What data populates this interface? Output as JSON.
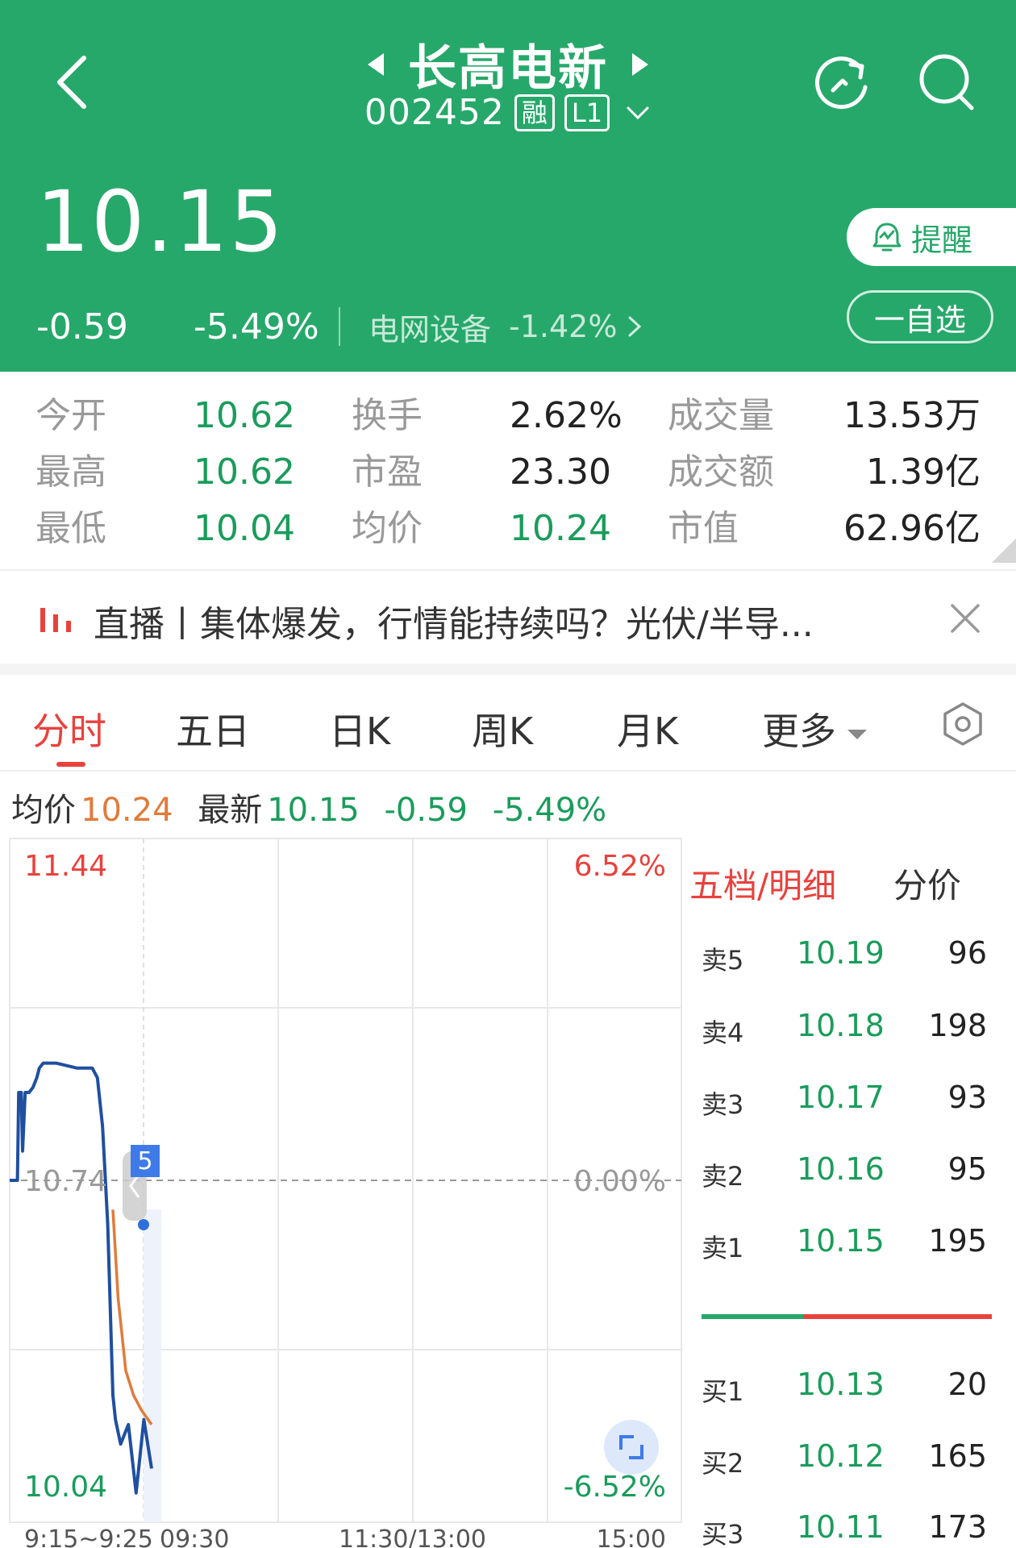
{
  "header": {
    "title": "长高电新",
    "code": "002452",
    "tag_margin": "融",
    "tag_level": "L1",
    "price": "10.15",
    "change": "-0.59",
    "change_pct": "-5.49%",
    "sector_name": "电网设备",
    "sector_change": "-1.42%",
    "remind_label": "提醒",
    "watchlist_label": "一自选"
  },
  "stats": [
    {
      "label": "今开",
      "value": "10.62",
      "color": "green"
    },
    {
      "label": "换手",
      "value": "2.62%",
      "color": "dark"
    },
    {
      "label": "成交量",
      "value": "13.53万",
      "color": "dark"
    },
    {
      "label": "最高",
      "value": "10.62",
      "color": "green"
    },
    {
      "label": "市盈",
      "value": "23.30",
      "color": "dark"
    },
    {
      "label": "成交额",
      "value": "1.39亿",
      "color": "dark"
    },
    {
      "label": "最低",
      "value": "10.04",
      "color": "green"
    },
    {
      "label": "均价",
      "value": "10.24",
      "color": "green"
    },
    {
      "label": "市值",
      "value": "62.96亿",
      "color": "dark"
    }
  ],
  "news": {
    "text": "直播丨集体爆发，行情能持续吗？光伏/半导..."
  },
  "tabs": [
    "分时",
    "五日",
    "日K",
    "周K",
    "月K",
    "更多"
  ],
  "info_line": {
    "avg_label": "均价",
    "avg_value": "10.24",
    "latest_label": "最新",
    "latest_value": "10.15",
    "change": "-0.59",
    "change_pct": "-5.49%"
  },
  "chart_data": {
    "type": "line",
    "y_top": "11.44",
    "y_mid": "10.74",
    "y_bottom": "10.04",
    "pct_top": "6.52%",
    "pct_mid": "0.00%",
    "pct_bottom": "-6.52%",
    "ylim": [
      10.04,
      11.44
    ],
    "x_labels": [
      "9:15~9:25",
      "09:30",
      "11:30/13:00",
      "15:00"
    ],
    "badge": "5",
    "series": [
      {
        "color": "#1f4fa0",
        "x": [
          0,
          0.3,
          0.35,
          0.45,
          0.5,
          0.6,
          0.75,
          0.9,
          1.05,
          1.15,
          1.3,
          1.8,
          2.6,
          3.2,
          3.4,
          3.6,
          3.8,
          4.0,
          4.1,
          4.3,
          4.6,
          4.9,
          5.2,
          5.5
        ],
        "y": [
          10.74,
          10.74,
          10.92,
          10.92,
          10.8,
          10.92,
          10.92,
          10.93,
          10.95,
          10.97,
          10.98,
          10.98,
          10.97,
          10.97,
          10.95,
          10.85,
          10.65,
          10.3,
          10.25,
          10.2,
          10.24,
          10.1,
          10.25,
          10.15
        ]
      },
      {
        "color": "#e07b3a",
        "x": [
          4.0,
          4.2,
          4.5,
          4.8,
          5.1,
          5.5
        ],
        "y": [
          10.68,
          10.5,
          10.35,
          10.3,
          10.27,
          10.24
        ]
      }
    ]
  },
  "order_book": {
    "tab_active": "五档/明细",
    "tab_other": "分价",
    "asks": [
      {
        "label": "卖5",
        "price": "10.19",
        "vol": "96"
      },
      {
        "label": "卖4",
        "price": "10.18",
        "vol": "198"
      },
      {
        "label": "卖3",
        "price": "10.17",
        "vol": "93"
      },
      {
        "label": "卖2",
        "price": "10.16",
        "vol": "95"
      },
      {
        "label": "卖1",
        "price": "10.15",
        "vol": "195"
      }
    ],
    "bids": [
      {
        "label": "买1",
        "price": "10.13",
        "vol": "20"
      },
      {
        "label": "买2",
        "price": "10.12",
        "vol": "165"
      },
      {
        "label": "买3",
        "price": "10.11",
        "vol": "173"
      }
    ],
    "buy_ratio": 0.35
  },
  "colors": {
    "header_green": "#26a86a",
    "up_red": "#e8423d",
    "down_green": "#1a9c5b",
    "avg_orange": "#e07b3a",
    "price_blue": "#1f4fa0"
  }
}
